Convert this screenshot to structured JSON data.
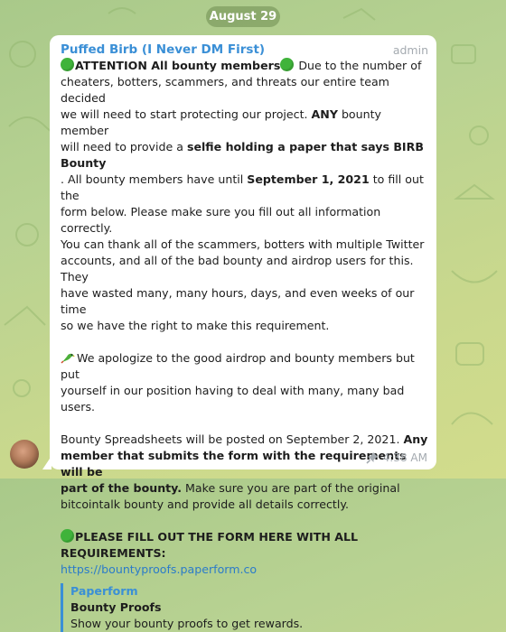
{
  "date_pill": "August 29",
  "message": {
    "sender": "Puffed Birb (I Never DM First)",
    "role": "admin",
    "lines": {
      "l1a": "ATTENTION All bounty members",
      "l1b": " Due to the number of",
      "l2": "cheaters, botters, scammers, and threats our entire team decided",
      "l3": "we will need to start protecting our project. ",
      "l3b": "ANY",
      "l3c": " bounty member",
      "l4": "will need to provide a ",
      "l4b": "selfie holding a paper that says BIRB Bounty",
      "l5": ". All bounty members have until ",
      "l5b": "September 1, 2021",
      "l5c": " to fill out the",
      "l6": "form below. Please make sure you fill out all information correctly.",
      "l7": "You can thank all of the scammers, botters with multiple Twitter",
      "l8": "accounts, and all of the bad bounty and airdrop users for this. They",
      "l9": "have wasted many, many hours, days, and even weeks of our time",
      "l10": "so we have the right to make this requirement.",
      "l11": "We apologize to the good airdrop and bounty members but put",
      "l12": "yourself in our position having to deal with many, many bad users.",
      "l13": "Bounty Spreadsheets will be posted on September 2, 2021. ",
      "l13b": "Any",
      "l14": "member that submits the form with the requirements will be",
      "l15": "part of the bounty.",
      "l15b": " Make sure you are part of the original",
      "l16": "bitcointalk bounty and provide all details correctly.",
      "l17": "PLEASE FILL OUT THE FORM HERE WITH ALL REQUIREMENTS:",
      "link": "https://bountyproofs.paperform.co"
    },
    "preview": {
      "site": "Paperform",
      "title": "Bounty Proofs",
      "description": "Show your bounty proofs to get rewards."
    },
    "time": "4:38 AM"
  },
  "icons": {
    "emoji_bullet": "green-circle",
    "emoji_parrot": "parrot",
    "pin": "pin-icon"
  }
}
